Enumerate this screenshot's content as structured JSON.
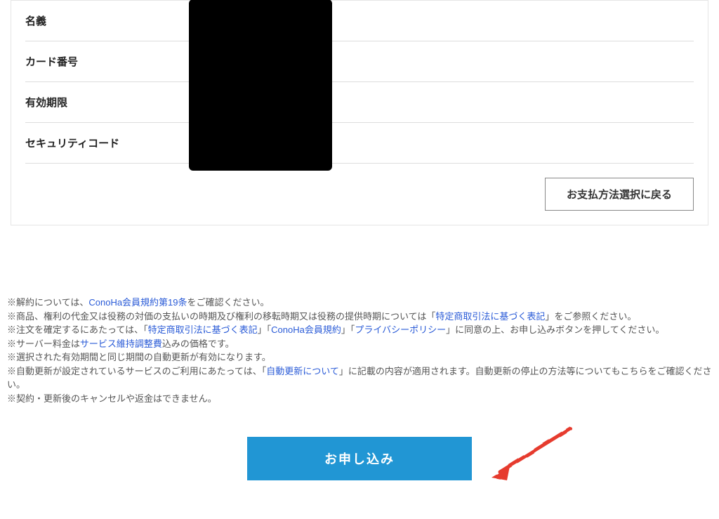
{
  "form": {
    "rows": [
      {
        "label": "名義"
      },
      {
        "label": "カード番号"
      },
      {
        "label": "有効期限"
      },
      {
        "label": "セキュリティコード"
      }
    ],
    "back_button": "お支払方法選択に戻る"
  },
  "notes": {
    "n1_pre": "※解約については、",
    "n1_link": "ConoHa会員規約第19条",
    "n1_post": "をご確認ください。",
    "n2_pre": "※商品、権利の代金又は役務の対価の支払いの時期及び権利の移転時期又は役務の提供時期については「",
    "n2_link": "特定商取引法に基づく表記",
    "n2_post": "」をご参照ください。",
    "n3_pre": "※注文を確定するにあたっては、「",
    "n3_link1": "特定商取引法に基づく表記",
    "n3_mid1": "」「",
    "n3_link2": "ConoHa会員規約",
    "n3_mid2": "」「",
    "n3_link3": "プライバシーポリシー",
    "n3_post": "」に同意の上、お申し込みボタンを押してください。",
    "n4_pre": "※サーバー料金は",
    "n4_link": "サービス維持調整費",
    "n4_post": "込みの価格です。",
    "n5": "※選択された有効期間と同じ期間の自動更新が有効になります。",
    "n6_pre": "※自動更新が設定されているサービスのご利用にあたっては、「",
    "n6_link": "自動更新について",
    "n6_post": "」に記載の内容が適用されます。自動更新の停止の方法等についてもこちらをご確認ください。",
    "n7": "※契約・更新後のキャンセルや返金はできません。"
  },
  "submit_label": "お申し込み"
}
